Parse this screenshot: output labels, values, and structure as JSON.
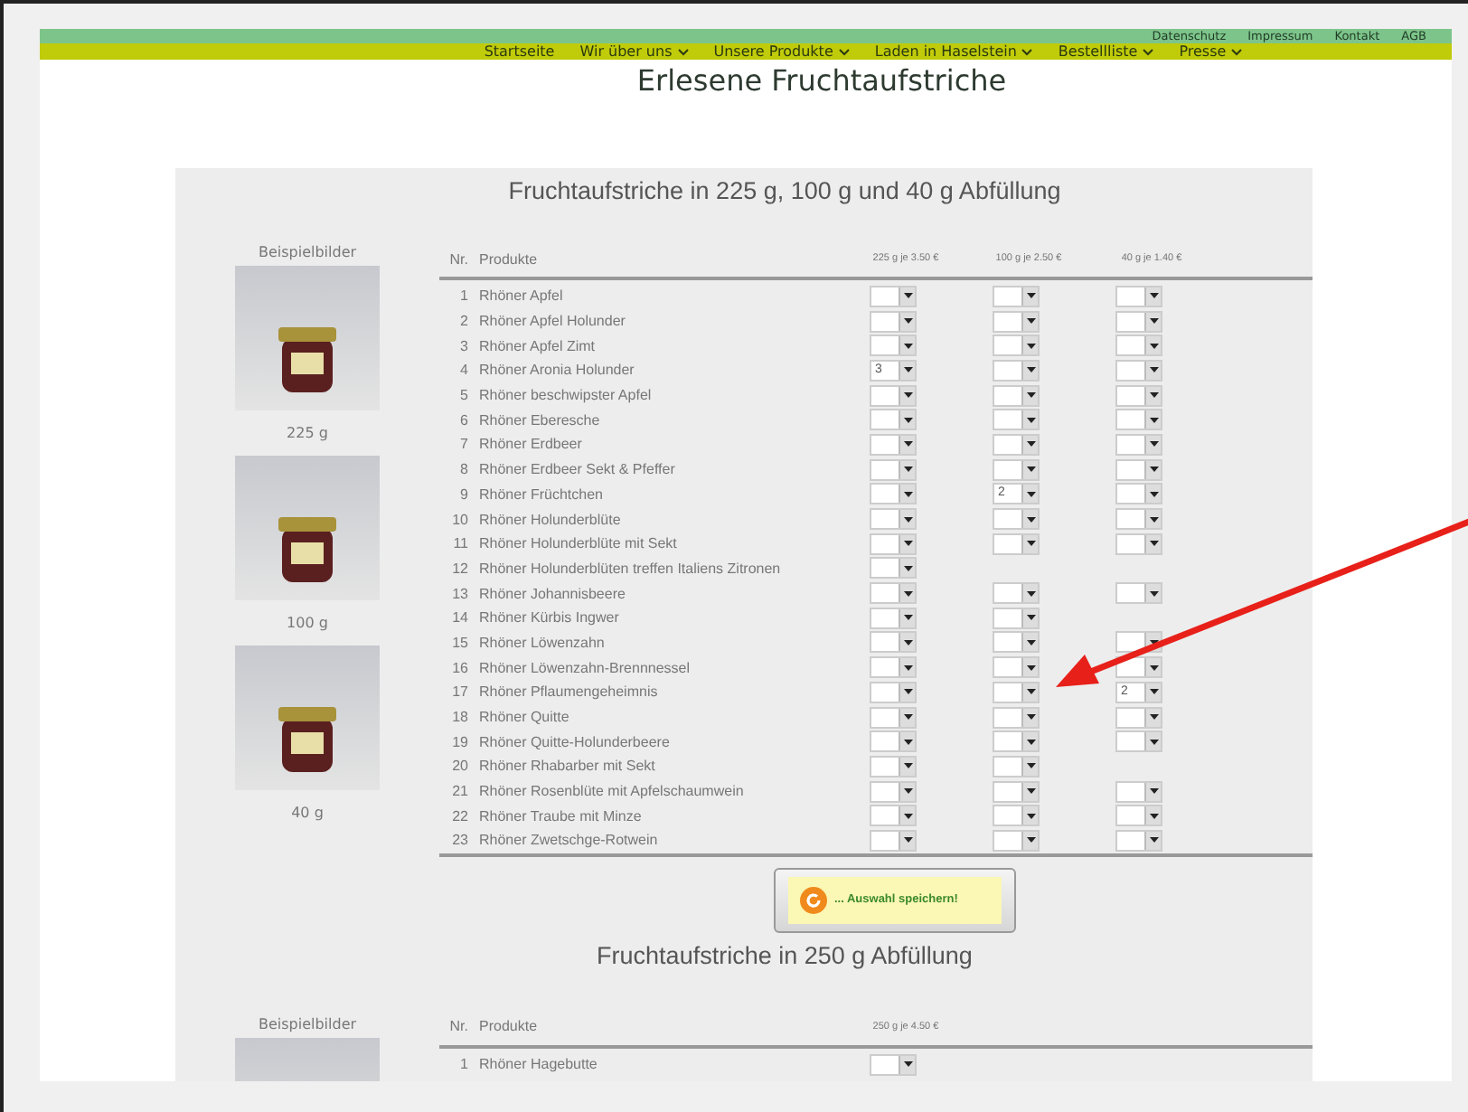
{
  "top_links": [
    "Datenschutz",
    "Impressum",
    "Kontakt",
    "AGB"
  ],
  "nav": [
    {
      "label": "Startseite",
      "dropdown": false
    },
    {
      "label": "Wir über uns",
      "dropdown": true
    },
    {
      "label": "Unsere Produkte",
      "dropdown": true
    },
    {
      "label": "Laden in Haselstein",
      "dropdown": true
    },
    {
      "label": "Bestellliste",
      "dropdown": true
    },
    {
      "label": "Presse",
      "dropdown": true
    }
  ],
  "page_title": "Erlesene Fruchtaufstriche",
  "sections": [
    {
      "title": "Fruchtaufstriche in 225 g, 100 g und 40 g Abfüllung",
      "side_label": "Beispielbilder",
      "images": [
        {
          "kind": "photo",
          "caption": "225 g"
        },
        {
          "kind": "photo",
          "caption": "100 g"
        },
        {
          "kind": "photo",
          "caption": "40 g"
        }
      ],
      "nr_header": "Nr.",
      "name_header": "Produkte",
      "size_headers": [
        "225 g je 3.50 €",
        "100 g je 2.50 €",
        "40 g je 1.40 €"
      ],
      "rows": [
        {
          "nr": "1",
          "name": "Rhöner Apfel",
          "cells": [
            {
              "kind": "select"
            },
            {
              "kind": "select"
            },
            {
              "kind": "select"
            }
          ]
        },
        {
          "nr": "2",
          "name": "Rhöner Apfel Holunder",
          "cells": [
            {
              "kind": "select"
            },
            {
              "kind": "select"
            },
            {
              "kind": "select"
            }
          ]
        },
        {
          "nr": "3",
          "name": "Rhöner Apfel Zimt",
          "cells": [
            {
              "kind": "select"
            },
            {
              "kind": "select"
            },
            {
              "kind": "select"
            }
          ]
        },
        {
          "nr": "4",
          "name": "Rhöner Aronia Holunder",
          "cells": [
            {
              "kind": "select",
              "value": "3"
            },
            {
              "kind": "select"
            },
            {
              "kind": "select"
            }
          ]
        },
        {
          "nr": "5",
          "name": "Rhöner beschwipster Apfel",
          "cells": [
            {
              "kind": "select"
            },
            {
              "kind": "select"
            },
            {
              "kind": "select"
            }
          ]
        },
        {
          "nr": "6",
          "name": "Rhöner Eberesche",
          "cells": [
            {
              "kind": "select"
            },
            {
              "kind": "select"
            },
            {
              "kind": "select"
            }
          ]
        },
        {
          "nr": "7",
          "name": "Rhöner Erdbeer",
          "cells": [
            {
              "kind": "select"
            },
            {
              "kind": "select"
            },
            {
              "kind": "select"
            }
          ]
        },
        {
          "nr": "8",
          "name": "Rhöner Erdbeer Sekt & Pfeffer",
          "cells": [
            {
              "kind": "select"
            },
            {
              "kind": "select"
            },
            {
              "kind": "select"
            }
          ]
        },
        {
          "nr": "9",
          "name": "Rhöner Früchtchen",
          "cells": [
            {
              "kind": "select"
            },
            {
              "kind": "select",
              "value": "2"
            },
            {
              "kind": "select"
            }
          ]
        },
        {
          "nr": "10",
          "name": "Rhöner Holunderblüte",
          "cells": [
            {
              "kind": "select"
            },
            {
              "kind": "select"
            },
            {
              "kind": "select"
            }
          ]
        },
        {
          "nr": "11",
          "name": "Rhöner Holunderblüte mit Sekt",
          "cells": [
            {
              "kind": "select"
            },
            {
              "kind": "select"
            },
            {
              "kind": "select"
            }
          ]
        },
        {
          "nr": "12",
          "name": "Rhöner Holunderblüten treffen Italiens Zitronen",
          "cells": [
            {
              "kind": "select"
            },
            {
              "kind": "none"
            },
            {
              "kind": "none"
            }
          ]
        },
        {
          "nr": "13",
          "name": "Rhöner Johannisbeere",
          "cells": [
            {
              "kind": "select"
            },
            {
              "kind": "select"
            },
            {
              "kind": "select"
            }
          ]
        },
        {
          "nr": "14",
          "name": "Rhöner Kürbis Ingwer",
          "cells": [
            {
              "kind": "select"
            },
            {
              "kind": "select"
            },
            {
              "kind": "none"
            }
          ]
        },
        {
          "nr": "15",
          "name": "Rhöner Löwenzahn",
          "cells": [
            {
              "kind": "select"
            },
            {
              "kind": "select"
            },
            {
              "kind": "select"
            }
          ]
        },
        {
          "nr": "16",
          "name": "Rhöner Löwenzahn-Brennnessel",
          "cells": [
            {
              "kind": "select"
            },
            {
              "kind": "select"
            },
            {
              "kind": "select"
            }
          ]
        },
        {
          "nr": "17",
          "name": "Rhöner Pflaumengeheimnis",
          "cells": [
            {
              "kind": "select"
            },
            {
              "kind": "select"
            },
            {
              "kind": "select",
              "value": "2"
            }
          ]
        },
        {
          "nr": "18",
          "name": "Rhöner Quitte",
          "cells": [
            {
              "kind": "select"
            },
            {
              "kind": "select"
            },
            {
              "kind": "select"
            }
          ]
        },
        {
          "nr": "19",
          "name": "Rhöner Quitte-Holunderbeere",
          "cells": [
            {
              "kind": "select"
            },
            {
              "kind": "select"
            },
            {
              "kind": "select"
            }
          ]
        },
        {
          "nr": "20",
          "name": "Rhöner Rhabarber mit Sekt",
          "cells": [
            {
              "kind": "select"
            },
            {
              "kind": "select"
            },
            {
              "kind": "none"
            }
          ]
        },
        {
          "nr": "21",
          "name": "Rhöner Rosenblüte mit Apfelschaumwein",
          "cells": [
            {
              "kind": "select"
            },
            {
              "kind": "select"
            },
            {
              "kind": "select"
            }
          ]
        },
        {
          "nr": "22",
          "name": "Rhöner Traube mit Minze",
          "cells": [
            {
              "kind": "select"
            },
            {
              "kind": "select"
            },
            {
              "kind": "select"
            }
          ]
        },
        {
          "nr": "23",
          "name": "Rhöner Zwetschge-Rotwein",
          "cells": [
            {
              "kind": "select"
            },
            {
              "kind": "select"
            },
            {
              "kind": "select"
            }
          ]
        }
      ],
      "save_button": "... Auswahl speichern!"
    },
    {
      "title": "Fruchtaufstriche in 250 g Abfüllung",
      "side_label": "Beispielbilder",
      "images": [
        {
          "kind": "photo"
        }
      ],
      "nr_header": "Nr.",
      "name_header": "Produkte",
      "size_headers": [
        "250 g je 4.50 €"
      ],
      "rows": [
        {
          "nr": "1",
          "name": "Rhöner Hagebutte",
          "cells": [
            {
              "kind": "select"
            }
          ]
        }
      ]
    }
  ]
}
